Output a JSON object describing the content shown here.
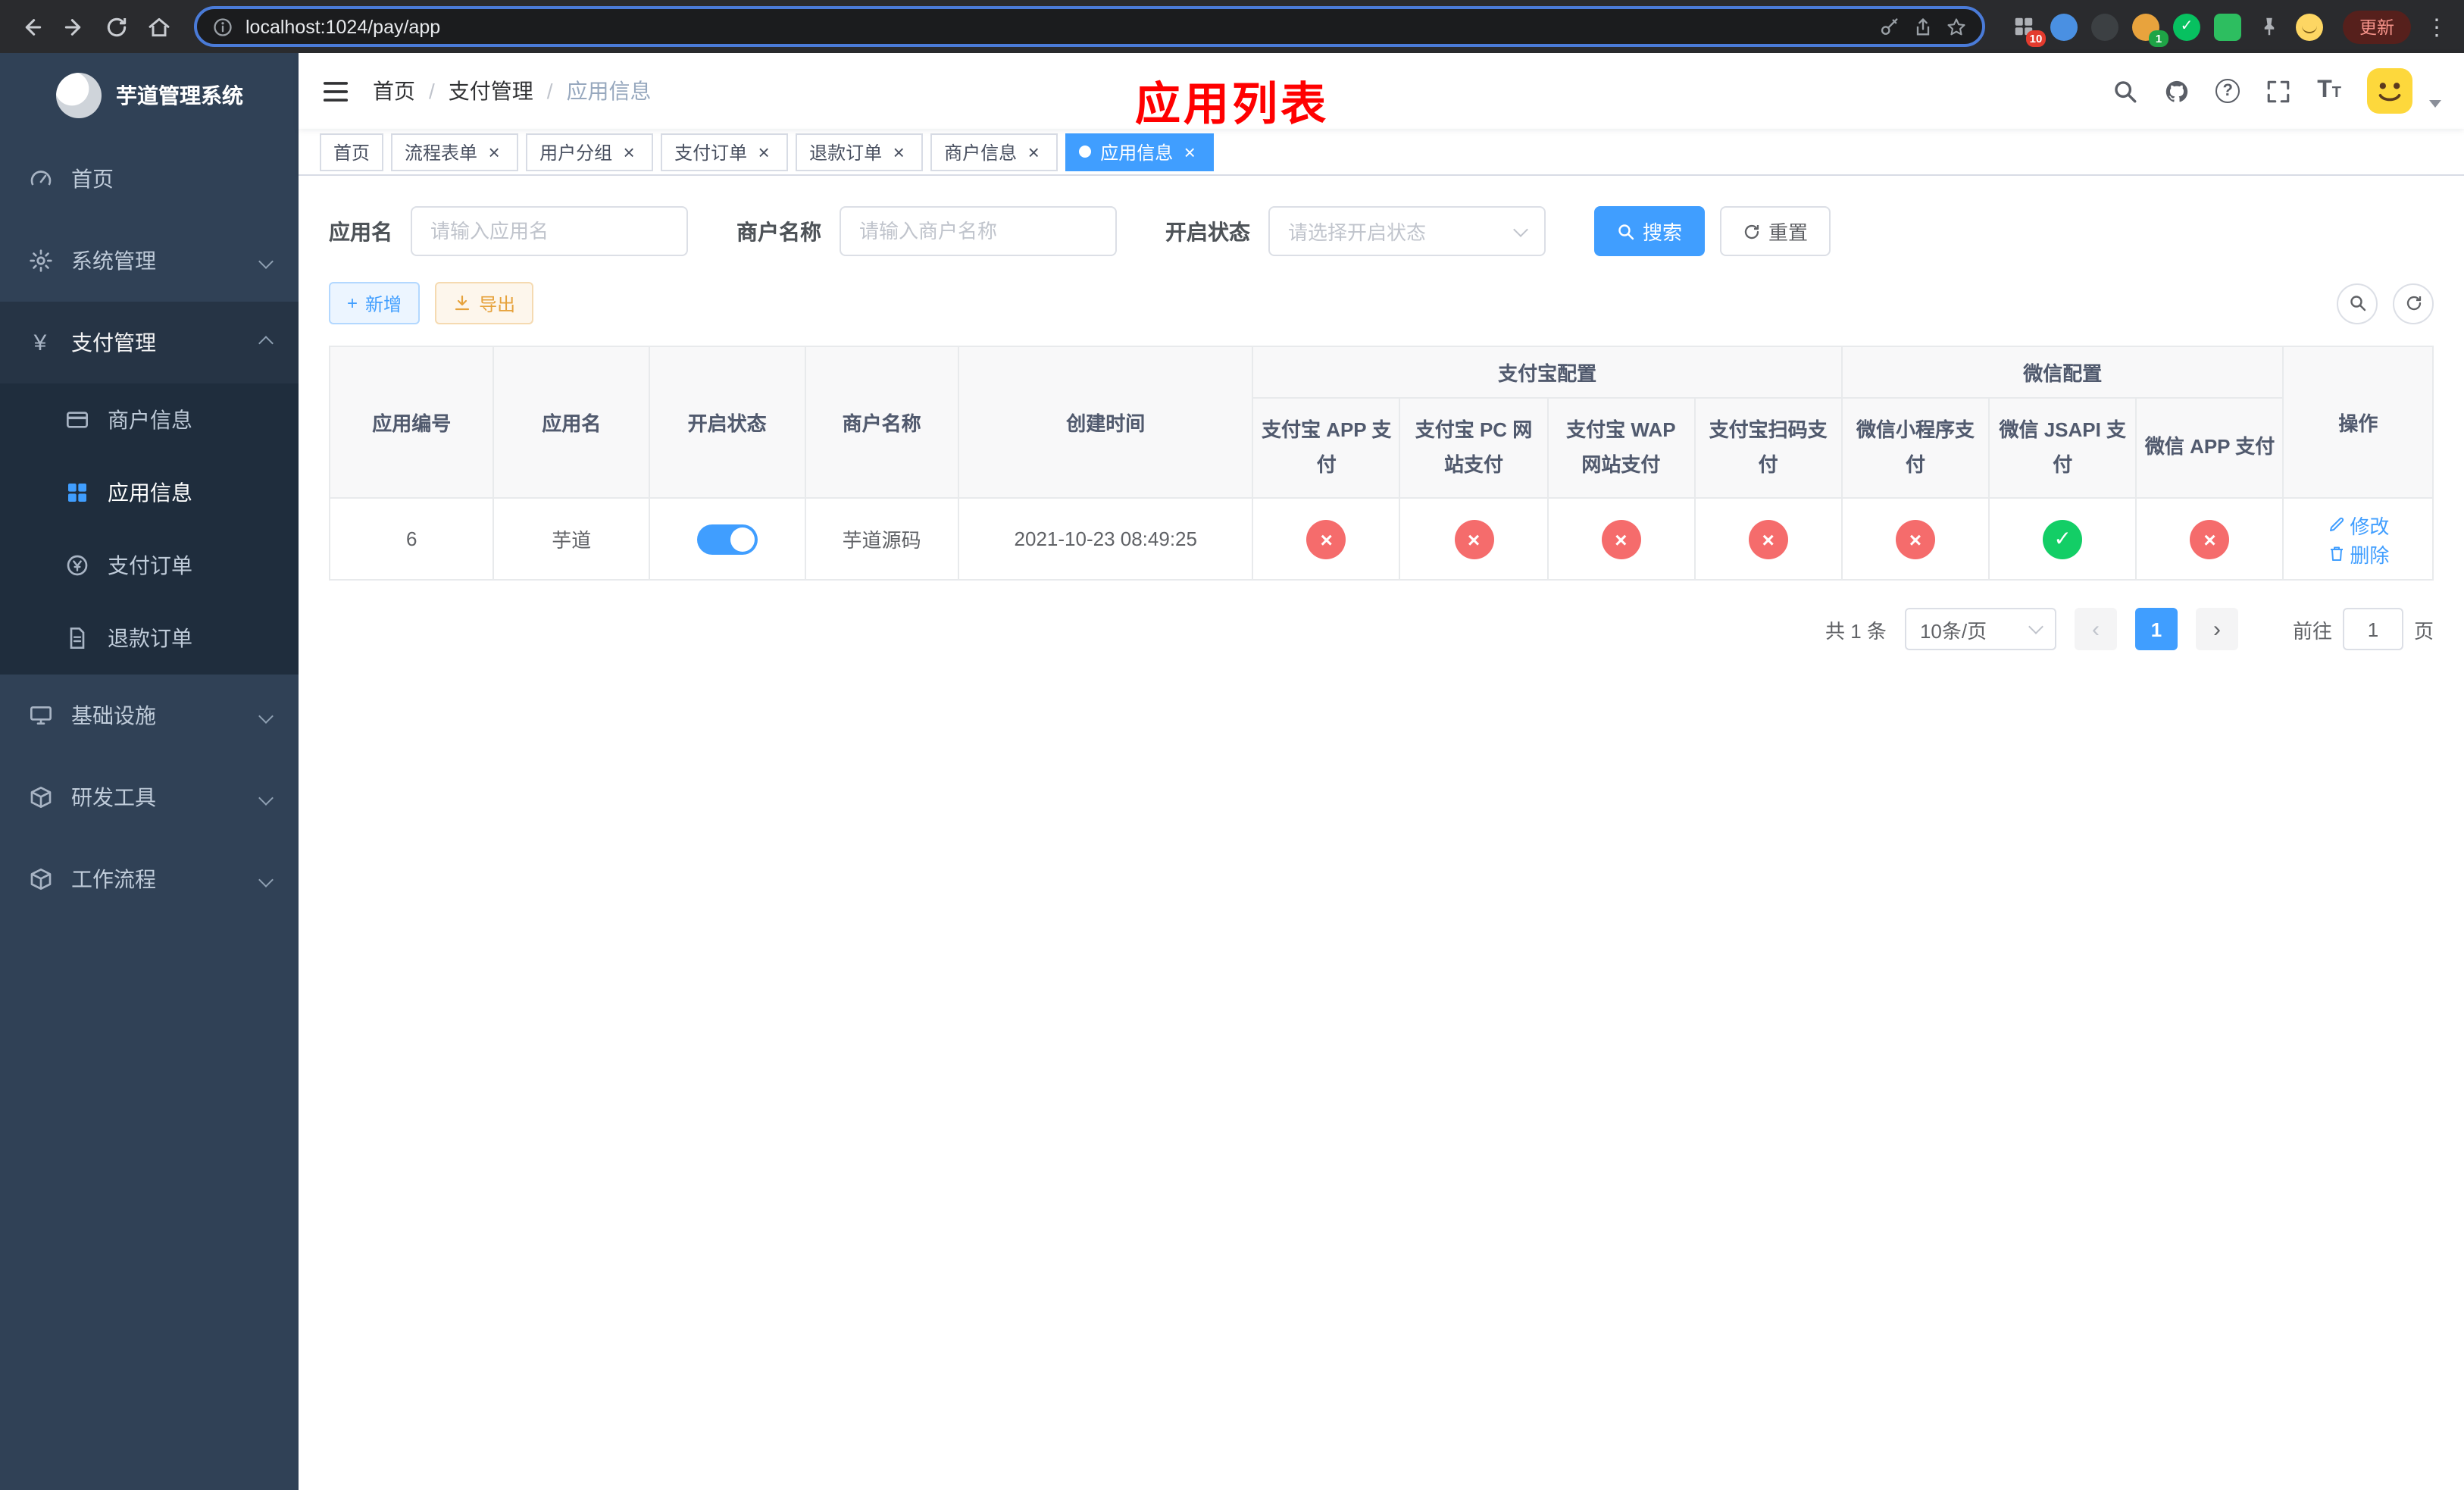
{
  "colors": {
    "primary": "#409EFF",
    "success": "#13ce66",
    "danger": "#f56c6c",
    "warning": "#e6a23c",
    "sidebar_bg": "#304156",
    "annotation": "#ff0000"
  },
  "icons": {
    "yen": "¥",
    "close": "×",
    "check": "✓",
    "plus": "+",
    "back": "←",
    "forward": "→",
    "menu_dots": "⋮",
    "question": "?",
    "prev": "‹",
    "next": "›",
    "breadcrumb_sep": "/",
    "font_size_big": "T",
    "font_size_small": "T"
  },
  "browser": {
    "url": "localhost:1024/pay/app",
    "update_label": "更新",
    "extension_badges": {
      "grid": "10",
      "avatar": "1"
    }
  },
  "sidebar": {
    "logo_title": "芋道管理系统",
    "items": [
      {
        "label": "首页"
      },
      {
        "label": "系统管理"
      },
      {
        "label": "支付管理"
      },
      {
        "label": "基础设施"
      },
      {
        "label": "研发工具"
      },
      {
        "label": "工作流程"
      }
    ],
    "payment_children": [
      {
        "label": "商户信息"
      },
      {
        "label": "应用信息"
      },
      {
        "label": "支付订单"
      },
      {
        "label": "退款订单"
      }
    ]
  },
  "header": {
    "breadcrumb": [
      "首页",
      "支付管理",
      "应用信息"
    ],
    "overlay_title": "应用列表"
  },
  "tabs": [
    {
      "label": "首页"
    },
    {
      "label": "流程表单"
    },
    {
      "label": "用户分组"
    },
    {
      "label": "支付订单"
    },
    {
      "label": "退款订单"
    },
    {
      "label": "商户信息"
    },
    {
      "label": "应用信息"
    }
  ],
  "filters": {
    "app_name_label": "应用名",
    "app_name_placeholder": "请输入应用名",
    "merchant_label": "商户名称",
    "merchant_placeholder": "请输入商户名称",
    "status_label": "开启状态",
    "status_placeholder": "请选择开启状态",
    "search_label": "搜索",
    "reset_label": "重置"
  },
  "toolbar": {
    "add_label": "新增",
    "export_label": "导出"
  },
  "table": {
    "headers": {
      "app_id": "应用编号",
      "app_name": "应用名",
      "status": "开启状态",
      "merchant": "商户名称",
      "created": "创建时间",
      "alipay_group": "支付宝配置",
      "wechat_group": "微信配置",
      "alipay_app": "支付宝 APP 支付",
      "alipay_pc": "支付宝 PC 网站支付",
      "alipay_wap": "支付宝 WAP 网站支付",
      "alipay_qr": "支付宝扫码支付",
      "wx_lite": "微信小程序支付",
      "wx_jsapi": "微信 JSAPI 支付",
      "wx_app": "微信 APP 支付",
      "actions": "操作"
    },
    "rows": [
      {
        "app_id": "6",
        "app_name": "芋道",
        "enabled": true,
        "merchant": "芋道源码",
        "created": "2021-10-23 08:49:25",
        "alipay_app": false,
        "alipay_pc": false,
        "alipay_wap": false,
        "alipay_qr": false,
        "wx_lite": false,
        "wx_jsapi": true,
        "wx_app": false
      }
    ],
    "row_actions": {
      "edit": "修改",
      "delete": "删除"
    }
  },
  "pagination": {
    "total_text": "共 1 条",
    "page_size_text": "10条/页",
    "current_page": "1",
    "goto_prefix": "前往",
    "goto_value": "1",
    "goto_suffix": "页"
  }
}
